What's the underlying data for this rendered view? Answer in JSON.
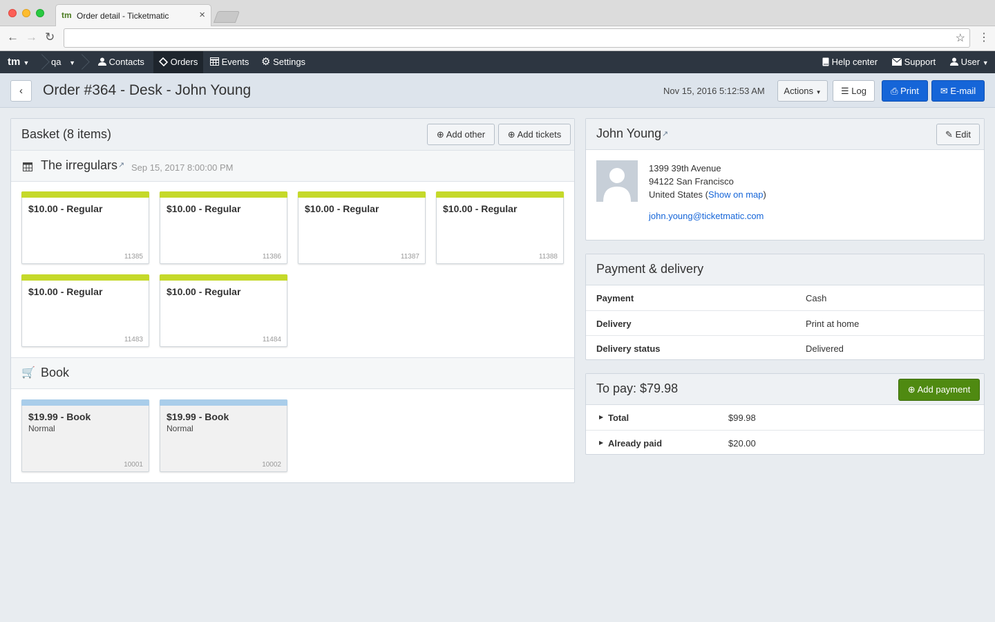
{
  "browser": {
    "tab_logo": "tm",
    "tab_title": "Order detail - Ticketmatic",
    "tab_close": "×",
    "url": ""
  },
  "nav": {
    "logo": "tm",
    "account": "qa",
    "contacts": "Contacts",
    "orders": "Orders",
    "events": "Events",
    "settings": "Settings",
    "help": "Help center",
    "support": "Support",
    "user": "User"
  },
  "header": {
    "title": "Order #364 - Desk - John Young",
    "timestamp": "Nov 15, 2016 5:12:53 AM",
    "actions": "Actions",
    "log": "Log",
    "print": "Print",
    "email": "E-mail"
  },
  "basket": {
    "title": "Basket (8 items)",
    "add_other": "Add other",
    "add_tickets": "Add tickets",
    "event_name": "The irregulars",
    "event_date": "Sep 15, 2017 8:00:00 PM",
    "tickets": [
      {
        "label": "$10.00 - Regular",
        "id": "11385"
      },
      {
        "label": "$10.00 - Regular",
        "id": "11386"
      },
      {
        "label": "$10.00 - Regular",
        "id": "11387"
      },
      {
        "label": "$10.00 - Regular",
        "id": "11388"
      },
      {
        "label": "$10.00 - Regular",
        "id": "11483"
      },
      {
        "label": "$10.00 - Regular",
        "id": "11484"
      }
    ],
    "product_group": "Book",
    "products": [
      {
        "label": "$19.99 - Book",
        "sub": "Normal",
        "id": "10001"
      },
      {
        "label": "$19.99 - Book",
        "sub": "Normal",
        "id": "10002"
      }
    ],
    "ticket_color": "#c5d92a",
    "product_color": "#a9cdea"
  },
  "contact": {
    "name": "John Young",
    "edit": "Edit",
    "address1": "1399 39th Avenue",
    "address2": "94122 San Francisco",
    "country": "United States (",
    "map_link": "Show on map",
    "country_close": ")",
    "email": "john.young@ticketmatic.com"
  },
  "payment_delivery": {
    "title": "Payment & delivery",
    "rows": [
      {
        "label": "Payment",
        "value": "Cash"
      },
      {
        "label": "Delivery",
        "value": "Print at home"
      },
      {
        "label": "Delivery status",
        "value": "Delivered"
      }
    ]
  },
  "to_pay": {
    "title": "To pay: $79.98",
    "add_payment": "Add payment",
    "rows": [
      {
        "label": "Total",
        "value": "$99.98"
      },
      {
        "label": "Already paid",
        "value": "$20.00"
      }
    ]
  }
}
